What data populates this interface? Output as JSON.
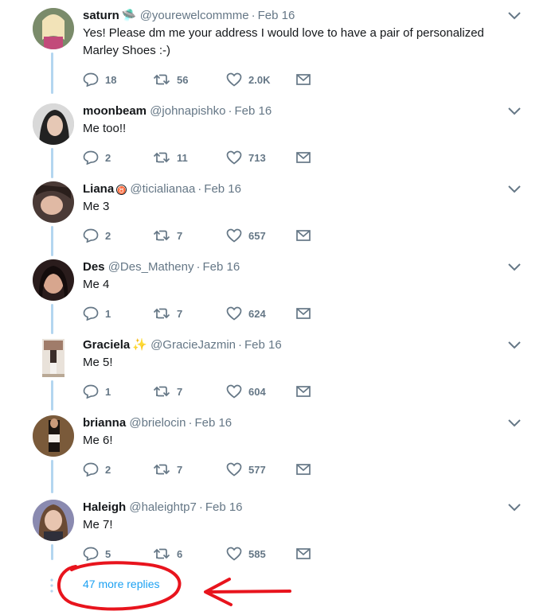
{
  "tweets": [
    {
      "name": "saturn",
      "badge": "🛸",
      "handle": "@yourewelcommme",
      "time": "Feb 16",
      "text": "Yes! Please dm me your address I would love to have a pair of personalized Marley Shoes :-)",
      "replies": "18",
      "retweets": "56",
      "likes": "2.0K",
      "avatar_color": "#7a8b6a"
    },
    {
      "name": "moonbeam",
      "badge": "",
      "handle": "@johnapishko",
      "time": "Feb 16",
      "text": "Me too!!",
      "replies": "2",
      "retweets": "11",
      "likes": "713",
      "avatar_color": "#8e8e8e"
    },
    {
      "name": "Liana",
      "badge": "♉",
      "handle": "@ticialianaa",
      "time": "Feb 16",
      "text": "Me 3",
      "replies": "2",
      "retweets": "7",
      "likes": "657",
      "avatar_color": "#5a4a44"
    },
    {
      "name": "Des",
      "badge": "",
      "handle": "@Des_Matheny",
      "time": "Feb 16",
      "text": "Me 4",
      "replies": "1",
      "retweets": "7",
      "likes": "624",
      "avatar_color": "#3d2a2a"
    },
    {
      "name": "Graciela",
      "badge": "✨",
      "handle": "@GracieJazmin",
      "time": "Feb 16",
      "text": "Me 5!",
      "replies": "1",
      "retweets": "7",
      "likes": "604",
      "avatar_color": "#c9b9a8"
    },
    {
      "name": "brianna",
      "badge": "",
      "handle": "@brielocin",
      "time": "Feb 16",
      "text": "Me 6!",
      "replies": "2",
      "retweets": "7",
      "likes": "577",
      "avatar_color": "#6b4a2e"
    },
    {
      "name": "Haleigh",
      "badge": "",
      "handle": "@haleightp7",
      "time": "Feb 16",
      "text": "Me 7!",
      "replies": "5",
      "retweets": "6",
      "likes": "585",
      "avatar_color": "#6e6a8a"
    }
  ],
  "more_replies": "47 more replies",
  "colors": {
    "accent": "#1da1f2",
    "muted": "#657786",
    "thread": "#b3d6f0",
    "annotation": "#e8141d"
  }
}
